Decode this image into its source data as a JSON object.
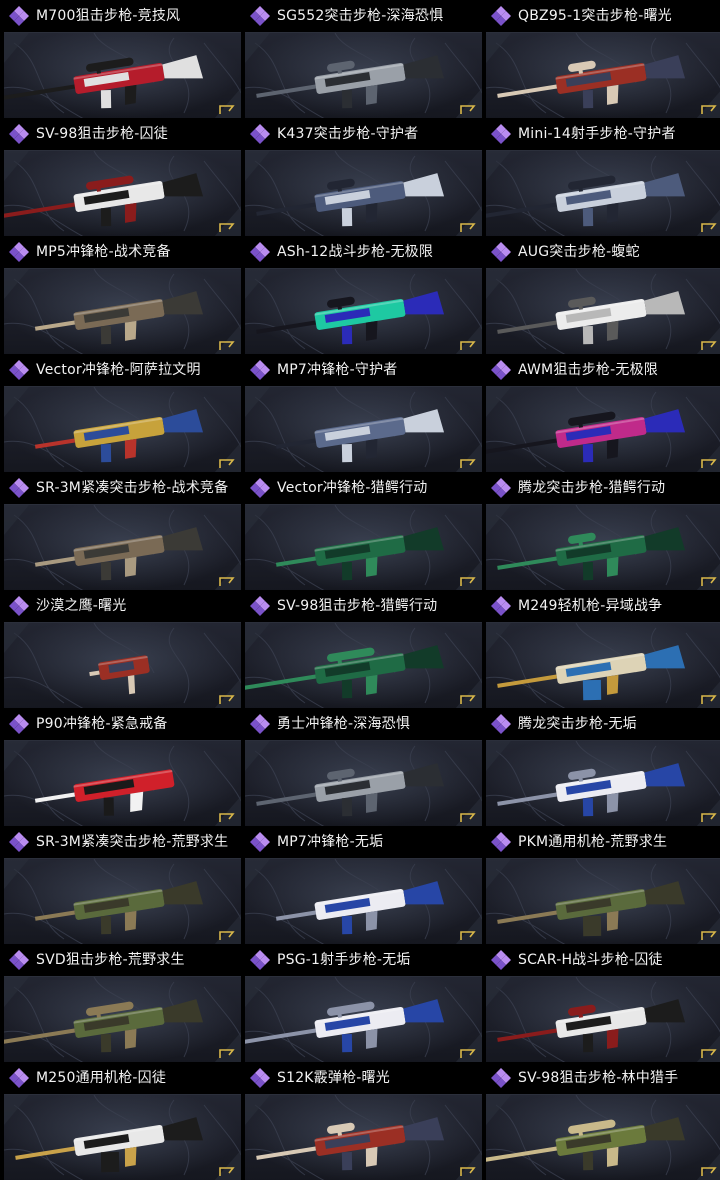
{
  "colors": {
    "rarity_accent": "#b98cf0",
    "rarity_accent_dark": "#7a52c9",
    "corner_mark": "#d9b84a"
  },
  "icons": {
    "rarity": "rarity-diamond-icon",
    "corner": "gold-corner-mark-icon"
  },
  "cards": [
    {
      "title": "M700狙击步枪-竞技风",
      "c1": "#b51c2b",
      "c2": "#e0e0e0",
      "c3": "#1c1c1c",
      "kind": "sniper"
    },
    {
      "title": "SG552突击步枪-深海恐惧",
      "c1": "#9aa0a8",
      "c2": "#2b2e33",
      "c3": "#5d6470",
      "kind": "rifle"
    },
    {
      "title": "QBZ95-1突击步枪-曙光",
      "c1": "#9b2f24",
      "c2": "#3a3f59",
      "c3": "#d8c9b5",
      "kind": "bullpup"
    },
    {
      "title": "SV-98狙击步枪-囚徒",
      "c1": "#e8e8e8",
      "c2": "#1c1c1c",
      "c3": "#8a1c1c",
      "kind": "sniper"
    },
    {
      "title": "K437突击步枪-守护者",
      "c1": "#4d5b7c",
      "c2": "#c9d0dc",
      "c3": "#222633",
      "kind": "rifle"
    },
    {
      "title": "Mini-14射手步枪-守护者",
      "c1": "#c9d0dc",
      "c2": "#4d5b7c",
      "c3": "#222633",
      "kind": "sniper"
    },
    {
      "title": "MP5冲锋枪-战术竞备",
      "c1": "#7a6a55",
      "c2": "#3b3a36",
      "c3": "#b9a88a",
      "kind": "smg"
    },
    {
      "title": "ASh-12战斗步枪-无极限",
      "c1": "#1ec9a2",
      "c2": "#2b2bb8",
      "c3": "#16161e",
      "kind": "bullpup"
    },
    {
      "title": "AUG突击步枪-蝮蛇",
      "c1": "#ececec",
      "c2": "#b8b8b8",
      "c3": "#5a5a5a",
      "kind": "bullpup"
    },
    {
      "title": "Vector冲锋枪-阿萨拉文明",
      "c1": "#c7a23b",
      "c2": "#2c4c9a",
      "c3": "#b8332b",
      "kind": "vector"
    },
    {
      "title": "MP7冲锋枪-守护者",
      "c1": "#5b6a8c",
      "c2": "#c9d0dc",
      "c3": "#222633",
      "kind": "smg"
    },
    {
      "title": "AWM狙击步枪-无极限",
      "c1": "#c02a8a",
      "c2": "#2b2bb8",
      "c3": "#16161e",
      "kind": "sniper"
    },
    {
      "title": "SR-3M紧凑突击步枪-战术竞备",
      "c1": "#7a6a55",
      "c2": "#3b3a36",
      "c3": "#a99a80",
      "kind": "smg"
    },
    {
      "title": "Vector冲锋枪-猎鳄行动",
      "c1": "#1f6b45",
      "c2": "#123b29",
      "c3": "#2f8a5a",
      "kind": "vector"
    },
    {
      "title": "腾龙突击步枪-猎鳄行动",
      "c1": "#1f6b45",
      "c2": "#123b29",
      "c3": "#2f8a5a",
      "kind": "rifle"
    },
    {
      "title": "沙漠之鹰-曙光",
      "c1": "#9b2f24",
      "c2": "#3a3f59",
      "c3": "#d8c9b5",
      "kind": "pistol"
    },
    {
      "title": "SV-98狙击步枪-猎鳄行动",
      "c1": "#1f6b45",
      "c2": "#123b29",
      "c3": "#2f8a5a",
      "kind": "sniper"
    },
    {
      "title": "M249轻机枪-异域战争",
      "c1": "#ddd3b6",
      "c2": "#2c6fb3",
      "c3": "#c49a3c",
      "kind": "lmg"
    },
    {
      "title": "P90冲锋枪-紧急戒备",
      "c1": "#d0202a",
      "c2": "#1a1a1a",
      "c3": "#f2f2f2",
      "kind": "p90"
    },
    {
      "title": "勇士冲锋枪-深海恐惧",
      "c1": "#9aa0a8",
      "c2": "#2b2e33",
      "c3": "#5d6470",
      "kind": "rifle"
    },
    {
      "title": "腾龙突击步枪-无垢",
      "c1": "#ececf2",
      "c2": "#2746a6",
      "c3": "#8c93a8",
      "kind": "rifle"
    },
    {
      "title": "SR-3M紧凑突击步枪-荒野求生",
      "c1": "#5a6a3c",
      "c2": "#3a3a2a",
      "c3": "#8b7a55",
      "kind": "smg"
    },
    {
      "title": "MP7冲锋枪-无垢",
      "c1": "#ececf2",
      "c2": "#2746a6",
      "c3": "#8c93a8",
      "kind": "smg"
    },
    {
      "title": "PKM通用机枪-荒野求生",
      "c1": "#5a6a3c",
      "c2": "#3a3a2a",
      "c3": "#8b7a55",
      "kind": "lmg"
    },
    {
      "title": "SVD狙击步枪-荒野求生",
      "c1": "#5a6a3c",
      "c2": "#3a3a2a",
      "c3": "#8b7a55",
      "kind": "sniper"
    },
    {
      "title": "PSG-1射手步枪-无垢",
      "c1": "#ececf2",
      "c2": "#2746a6",
      "c3": "#8c93a8",
      "kind": "sniper"
    },
    {
      "title": "SCAR-H战斗步枪-囚徒",
      "c1": "#e8e8e8",
      "c2": "#1c1c1c",
      "c3": "#8a1c1c",
      "kind": "rifle"
    },
    {
      "title": "M250通用机枪-囚徒",
      "c1": "#e8e8e8",
      "c2": "#1c1c1c",
      "c3": "#c9a24a",
      "kind": "lmg"
    },
    {
      "title": "S12K霰弹枪-曙光",
      "c1": "#9b2f24",
      "c2": "#3a3f59",
      "c3": "#d8c9b5",
      "kind": "rifle"
    },
    {
      "title": "SV-98狙击步枪-林中猎手",
      "c1": "#6b7a3c",
      "c2": "#3a3a2a",
      "c3": "#c9b98a",
      "kind": "sniper"
    }
  ]
}
